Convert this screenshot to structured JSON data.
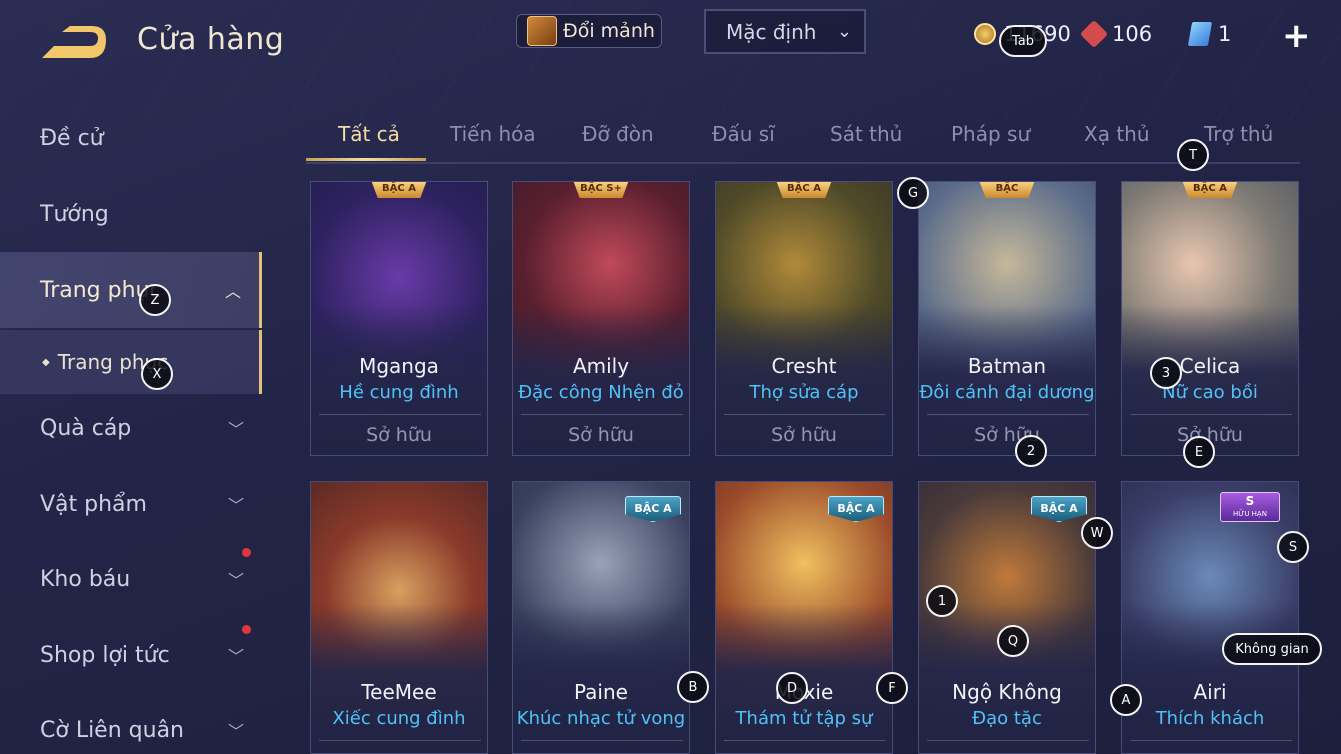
{
  "header": {
    "title": "Cửa hàng",
    "exchange_label": "Đổi mảnh",
    "sort_value": "Mặc định",
    "currencies": [
      {
        "icon": "gold-coin-icon",
        "value": "11690"
      },
      {
        "icon": "red-gem-icon",
        "value": "106"
      },
      {
        "icon": "ticket-icon",
        "value": "1"
      }
    ]
  },
  "sidebar": {
    "items": [
      {
        "label": "Đề cử"
      },
      {
        "label": "Tướng"
      },
      {
        "label": "Trang phục"
      },
      {
        "label": "Quà cáp"
      },
      {
        "label": "Vật phẩm"
      },
      {
        "label": "Kho báu"
      },
      {
        "label": "Shop lợi tức"
      },
      {
        "label": "Cờ Liên quân"
      }
    ],
    "sub_item": "Trang phục"
  },
  "tabs": [
    "Tất cả",
    "Tiến hóa",
    "Đỡ đòn",
    "Đấu sĩ",
    "Sát thủ",
    "Pháp sư",
    "Xạ thủ",
    "Trợ thủ"
  ],
  "cards": [
    {
      "hero": "Mganga",
      "skin": "Hề cung đình",
      "status": "Sở hữu",
      "badge": "BẬC A"
    },
    {
      "hero": "Amily",
      "skin": "Đặc công Nhện đỏ",
      "status": "Sở hữu",
      "badge": "BẬC S+"
    },
    {
      "hero": "Cresht",
      "skin": "Thợ sửa cáp",
      "status": "Sở hữu",
      "badge": "BẬC A"
    },
    {
      "hero": "Batman",
      "skin": "Đôi cánh đại dương",
      "status": "Sở hữu",
      "badge": "BẬC"
    },
    {
      "hero": "Celica",
      "skin": "Nữ cao bồi",
      "status": "Sở hữu",
      "badge": "BẬC A"
    },
    {
      "hero": "TeeMee",
      "skin": "Xiếc cung đình",
      "badge": ""
    },
    {
      "hero": "Paine",
      "skin": "Khúc nhạc tử vong",
      "badge": "BẬC A"
    },
    {
      "hero": "Moxie",
      "skin": "Thám tử tập sự",
      "badge": "BẬC A"
    },
    {
      "hero": "Ngộ Không",
      "skin": "Đạo tặc",
      "badge": "BẬC A"
    },
    {
      "hero": "Airi",
      "skin": "Thích khách",
      "badge": "S",
      "badge_sub": "HỮU HẠN"
    }
  ],
  "key_hints": [
    "Tab",
    "Z",
    "X",
    "G",
    "T",
    "3",
    "2",
    "E",
    "W",
    "S",
    "1",
    "Q",
    "B",
    "D",
    "F",
    "A",
    "Không gian"
  ],
  "colors": {
    "accent_gold": "#f5dba4",
    "skin_blue": "#4fc3f7",
    "notify_red": "#e0383a"
  }
}
